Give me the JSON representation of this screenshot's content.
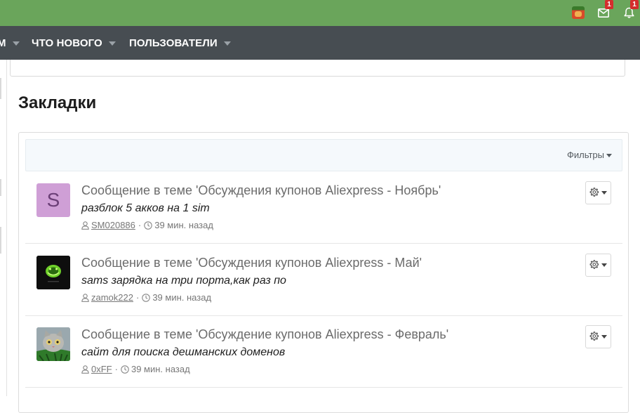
{
  "header": {
    "icons": {
      "avatar": "user-avatar-icon",
      "mail": "mail-icon",
      "bell": "bell-icon"
    },
    "mail_badge": "1",
    "alerts_badge": "1",
    "colors": {
      "topbar": "#6aa55b",
      "navbar": "#474d52"
    }
  },
  "nav": {
    "items": [
      {
        "label": "М"
      },
      {
        "label": "ЧТО НОВОГО"
      },
      {
        "label": "ПОЛЬЗОВАТЕЛИ"
      }
    ]
  },
  "page": {
    "title": "Закладки"
  },
  "filters": {
    "label": "Фильтры"
  },
  "bookmarks": [
    {
      "avatar_letter": "S",
      "title": "Сообщение в теме 'Обсуждения купонов Aliexpress - Ноябрь'",
      "snippet": "разблок 5 акков на 1 sim",
      "user": "SM020886",
      "sep": "·",
      "time": "39 мин. назад"
    },
    {
      "avatar_letter": "",
      "title": "Сообщение в теме 'Обсуждения купонов Aliexpress - Май'",
      "snippet": "sams зарядка на три порта,как раз по",
      "user": "zamok222",
      "sep": "·",
      "time": "39 мин. назад"
    },
    {
      "avatar_letter": "",
      "title": "Сообщение в теме 'Обсуждение купонов Aliexpress - Февраль'",
      "snippet": "сайт для поиска дешманских доменов",
      "user": "0xFF",
      "sep": "·",
      "time": "39 мин. назад"
    }
  ]
}
